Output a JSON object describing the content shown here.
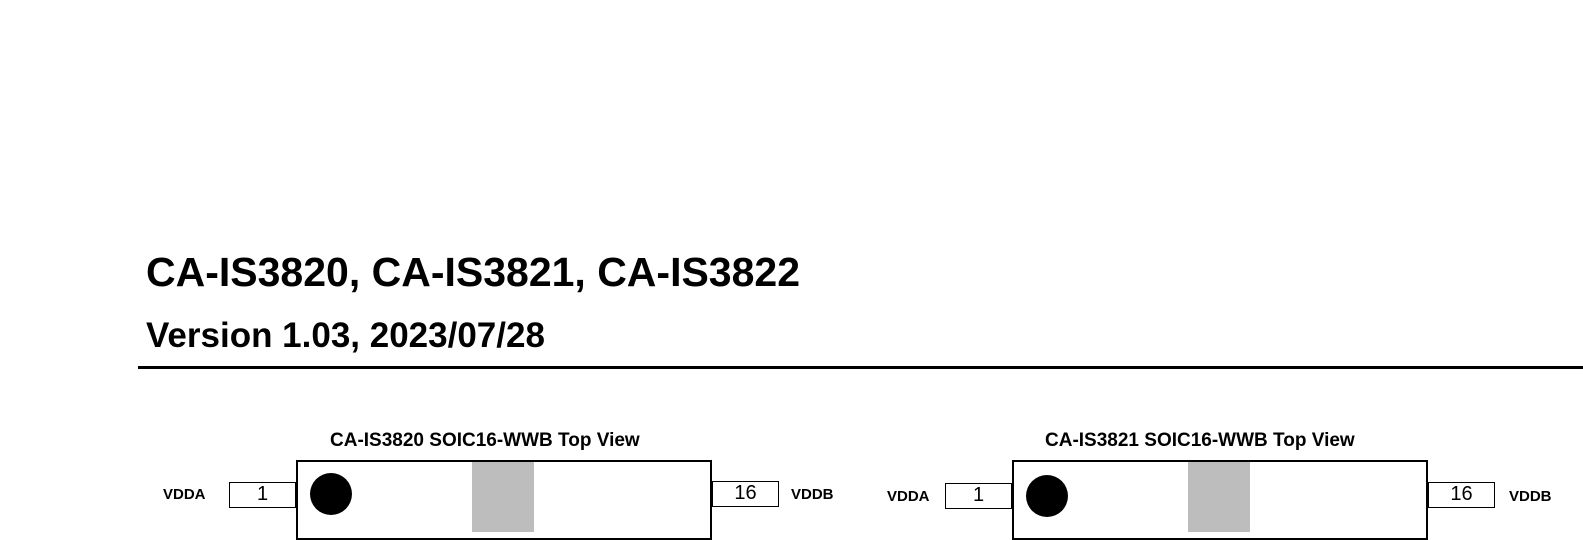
{
  "header": {
    "title": "CA-IS3820, CA-IS3821, CA-IS3822",
    "version": "Version 1.03, 2023/07/28"
  },
  "packages": [
    {
      "title": "CA-IS3820 SOIC16-WWB Top View",
      "left_pin": {
        "number": "1",
        "name": "VDDA"
      },
      "right_pin": {
        "number": "16",
        "name": "VDDB"
      }
    },
    {
      "title": "CA-IS3821 SOIC16-WWB Top View",
      "left_pin": {
        "number": "1",
        "name": "VDDA"
      },
      "right_pin": {
        "number": "16",
        "name": "VDDB"
      }
    }
  ]
}
